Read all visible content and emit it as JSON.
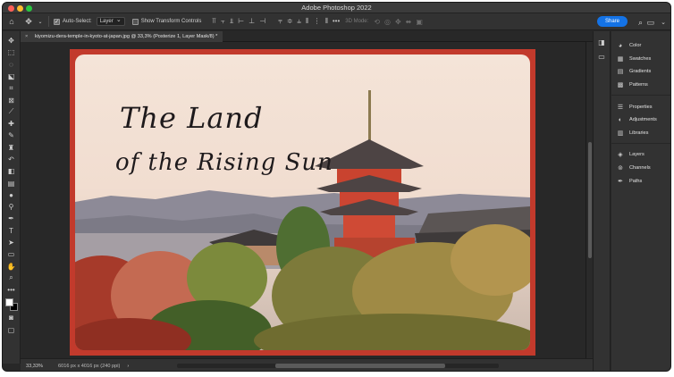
{
  "window": {
    "title": "Adobe Photoshop 2022"
  },
  "options_bar": {
    "auto_select_label": "Auto-Select:",
    "auto_select_checked": true,
    "auto_select_target": "Layer",
    "show_transform_controls_label": "Show Transform Controls",
    "three_d_mode_label": "3D Mode:",
    "share_label": "Share"
  },
  "document": {
    "tab_title": "kiyomizu-dera-temple-in-kyoto-at-japan.jpg @ 33,3% (Posterize 1, Layer Mask/8) *",
    "tagline_line1": "The Land",
    "tagline_line2": "of the Rising Sun",
    "frame_color": "#c23a2c"
  },
  "status_bar": {
    "zoom": "33,33%",
    "doc_info": "6016 px x 4016 px (240 ppi)",
    "arrow": "›"
  },
  "panels": {
    "group1": [
      {
        "label": "Color",
        "icon": "color-wheel-icon"
      },
      {
        "label": "Swatches",
        "icon": "grid-icon"
      },
      {
        "label": "Gradients",
        "icon": "gradient-icon"
      },
      {
        "label": "Patterns",
        "icon": "pattern-icon"
      }
    ],
    "group2": [
      {
        "label": "Properties",
        "icon": "sliders-icon"
      },
      {
        "label": "Adjustments",
        "icon": "half-circle-icon"
      },
      {
        "label": "Libraries",
        "icon": "library-icon"
      }
    ],
    "group3": [
      {
        "label": "Layers",
        "icon": "layers-icon"
      },
      {
        "label": "Channels",
        "icon": "channels-icon"
      },
      {
        "label": "Paths",
        "icon": "paths-icon"
      }
    ]
  }
}
